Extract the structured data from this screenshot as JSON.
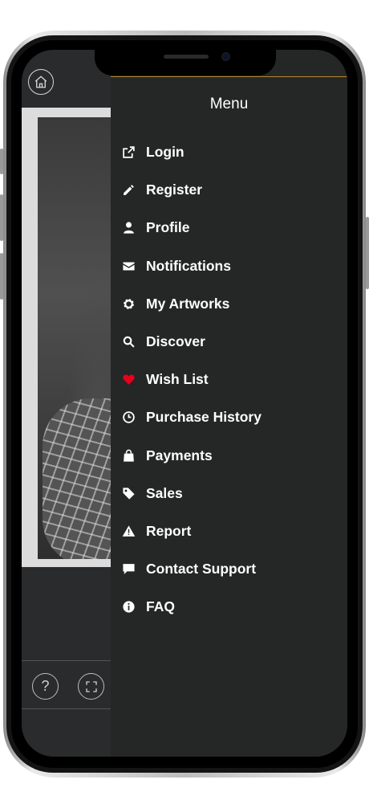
{
  "menu": {
    "title": "Menu",
    "items": [
      {
        "label": "Login",
        "icon": "login-icon"
      },
      {
        "label": "Register",
        "icon": "pencil-icon"
      },
      {
        "label": "Profile",
        "icon": "user-icon"
      },
      {
        "label": "Notifications",
        "icon": "envelope-icon"
      },
      {
        "label": "My Artworks",
        "icon": "gear-icon"
      },
      {
        "label": "Discover",
        "icon": "search-icon"
      },
      {
        "label": "Wish List",
        "icon": "heart-icon"
      },
      {
        "label": "Purchase History",
        "icon": "clock-icon"
      },
      {
        "label": "Payments",
        "icon": "shopping-bag-icon"
      },
      {
        "label": "Sales",
        "icon": "tag-icon"
      },
      {
        "label": "Report",
        "icon": "warning-icon"
      },
      {
        "label": "Contact Support",
        "icon": "chat-icon"
      },
      {
        "label": "FAQ",
        "icon": "info-icon"
      }
    ]
  },
  "background": {
    "help_label": "?",
    "icons": [
      "home-icon",
      "help-icon",
      "fullscreen-icon"
    ]
  },
  "colors": {
    "menu_bg": "#252626",
    "accent_line": "#b58a2e",
    "heart": "#e8001c",
    "text": "#ffffff"
  }
}
